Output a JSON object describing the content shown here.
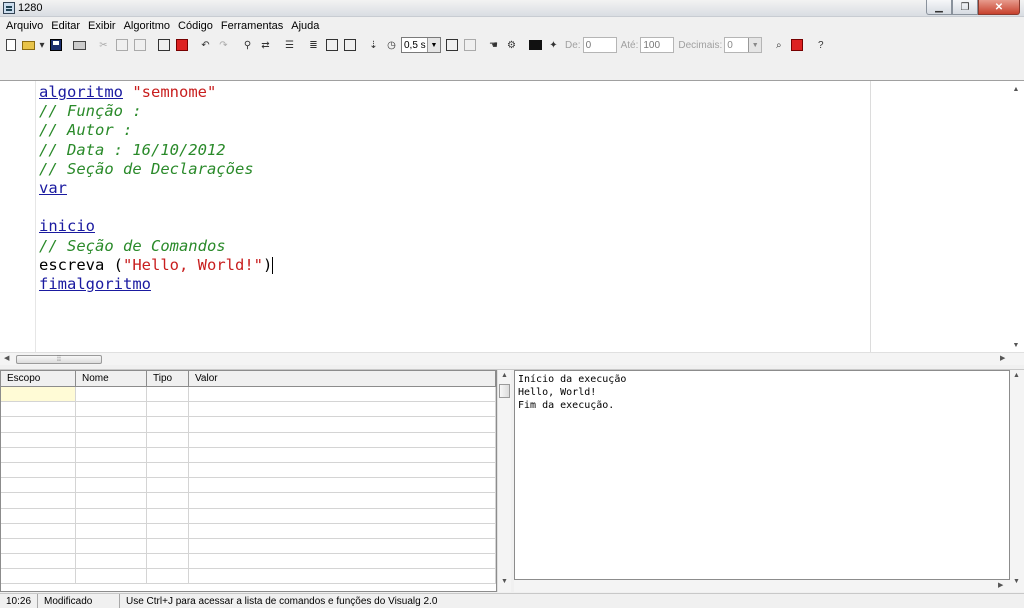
{
  "window": {
    "title": "1280"
  },
  "menu": [
    "Arquivo",
    "Editar",
    "Exibir",
    "Algoritmo",
    "Código",
    "Ferramentas",
    "Ajuda"
  ],
  "toolbar": {
    "speed_select": "0,5 s",
    "de_label": "De:",
    "de_value": "0",
    "ate_label": "Até:",
    "ate_value": "100",
    "decimais_label": "Decimais:",
    "decimais_value": "0"
  },
  "editor": {
    "lines": [
      {
        "segments": [
          {
            "cls": "kw",
            "text": "algoritmo"
          },
          {
            "cls": "plain",
            "text": " "
          },
          {
            "cls": "str",
            "text": "\"semnome\""
          }
        ]
      },
      {
        "segments": [
          {
            "cls": "cmt",
            "text": "// Função :"
          }
        ]
      },
      {
        "segments": [
          {
            "cls": "cmt",
            "text": "// Autor :"
          }
        ]
      },
      {
        "segments": [
          {
            "cls": "cmt",
            "text": "// Data : 16/10/2012"
          }
        ]
      },
      {
        "segments": [
          {
            "cls": "cmt",
            "text": "// Seção de Declarações"
          }
        ]
      },
      {
        "segments": [
          {
            "cls": "kw",
            "text": "var"
          }
        ]
      },
      {
        "segments": []
      },
      {
        "segments": [
          {
            "cls": "kw",
            "text": "inicio"
          }
        ]
      },
      {
        "segments": [
          {
            "cls": "cmt",
            "text": "// Seção de Comandos"
          }
        ]
      },
      {
        "segments": [
          {
            "cls": "plain",
            "text": "escreva ("
          },
          {
            "cls": "str",
            "text": "\"Hello, World!\""
          },
          {
            "cls": "plain",
            "text": ")"
          }
        ],
        "caret": true
      },
      {
        "segments": [
          {
            "cls": "kw",
            "text": "fimalgoritmo"
          }
        ]
      }
    ]
  },
  "variables": {
    "columns": [
      "Escopo",
      "Nome",
      "Tipo",
      "Valor"
    ],
    "row_count": 13
  },
  "output": {
    "lines": [
      "Início da execução",
      "Hello, World!",
      "Fim da execução."
    ]
  },
  "status": {
    "position": "10:26",
    "state": "Modificado",
    "hint": "Use Ctrl+J para acessar a lista de comandos e funções do Visualg 2.0"
  }
}
